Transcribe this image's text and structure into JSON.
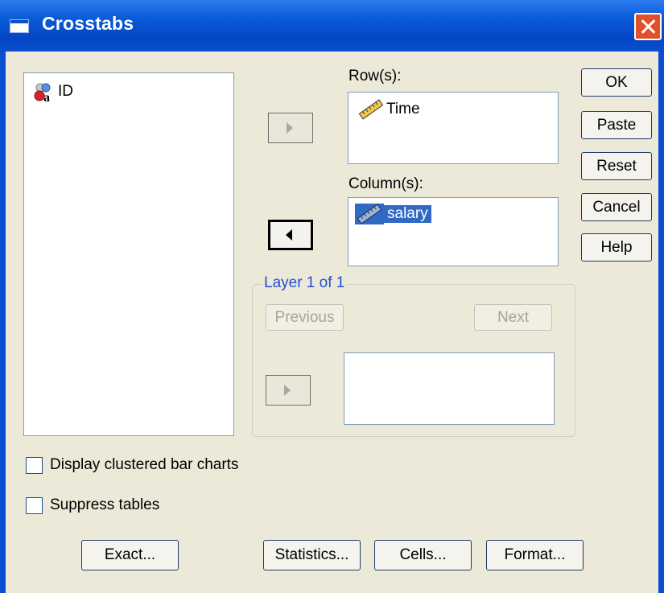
{
  "window": {
    "title": "Crosstabs"
  },
  "source_list": {
    "items": [
      {
        "label": "ID",
        "icon": "nominal-string-variable-icon"
      }
    ]
  },
  "rows": {
    "label": "Row(s):",
    "items": [
      {
        "label": "Time",
        "icon": "scale-ruler-icon"
      }
    ]
  },
  "columns": {
    "label": "Column(s):",
    "items": [
      {
        "label": "salary",
        "icon": "scale-ruler-icon",
        "selected": true
      }
    ]
  },
  "layer": {
    "label": "Layer 1 of 1",
    "previous_label": "Previous",
    "next_label": "Next"
  },
  "side_buttons": {
    "ok": "OK",
    "paste": "Paste",
    "reset": "Reset",
    "cancel": "Cancel",
    "help": "Help"
  },
  "options": {
    "clustered_bar": "Display clustered bar charts",
    "clustered_bar_checked": false,
    "suppress": "Suppress tables",
    "suppress_checked": false
  },
  "bottom_buttons": {
    "exact": "Exact...",
    "statistics": "Statistics...",
    "cells": "Cells...",
    "format": "Format..."
  },
  "colors": {
    "titlebar": "#0a4fcf",
    "dialog_bg": "#ece9d8",
    "selection": "#316ac5",
    "group_label": "#1f4fd6"
  }
}
